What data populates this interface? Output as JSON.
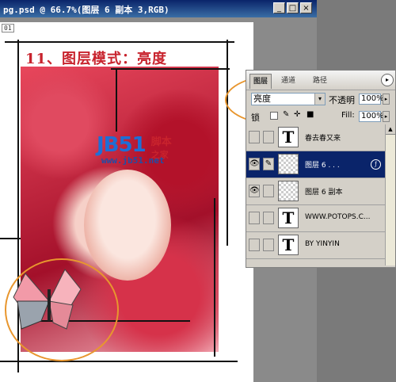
{
  "window": {
    "title": "pg.psd @ 66.7%(图层 6 副本 3,RGB)",
    "min_label": "_",
    "max_label": "□",
    "close_label": "×"
  },
  "document": {
    "tag": "01",
    "heading": "11、图层模式：亮度",
    "watermark_logo": "JB51",
    "watermark_cn_top": "脚本",
    "watermark_cn_bottom": "之家",
    "watermark_url": "www.jb51.net"
  },
  "panel": {
    "tabs": [
      "图层",
      "通道",
      "路径"
    ],
    "menu_icon": "▸",
    "blend_mode": "亮度",
    "blend_dropdown": "▾",
    "opacity_label": "不透明",
    "opacity_value": "100%",
    "lock_label": "锁",
    "fill_label": "Fill:",
    "fill_value": "100%",
    "layers": [
      {
        "name": "春去春又来",
        "thumb": "T",
        "visible": false,
        "selected": false
      },
      {
        "name": "图层 6 . . .",
        "thumb": "",
        "visible": true,
        "selected": true
      },
      {
        "name": "图层 6 副本",
        "thumb": "",
        "visible": true,
        "selected": false
      },
      {
        "name": "WWW.POTOPS.C...",
        "thumb": "T",
        "visible": false,
        "selected": false
      },
      {
        "name": "BY  YINYIN",
        "thumb": "T",
        "visible": false,
        "selected": false
      }
    ]
  },
  "colors": {
    "heading": "#c8232d",
    "annotation": "#e8962e",
    "selection": "#0a246a"
  }
}
